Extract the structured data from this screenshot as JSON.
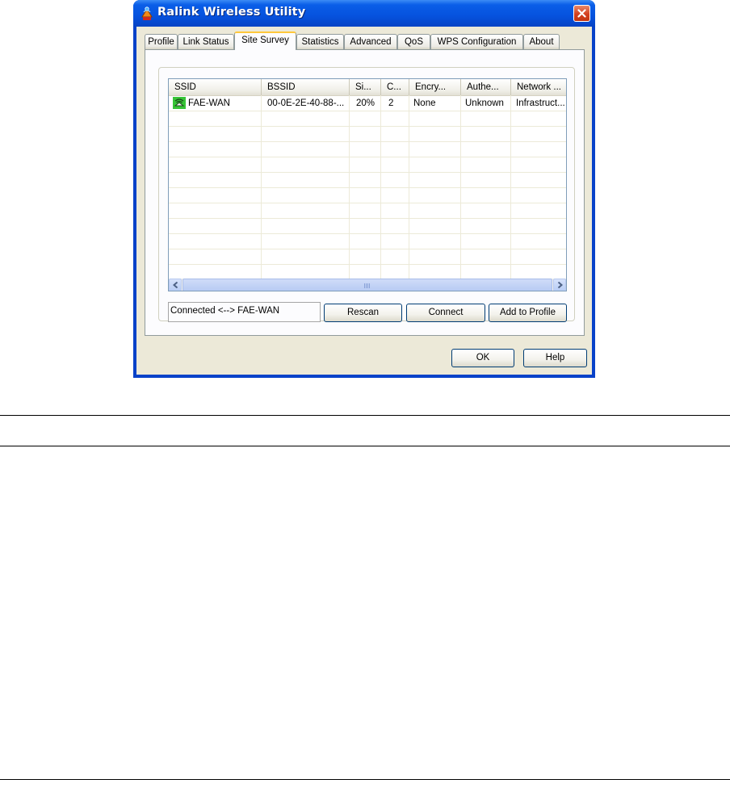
{
  "window": {
    "title": "Ralink Wireless Utility",
    "close_icon": "close-icon",
    "app_icon": "ralink-app-icon"
  },
  "tabs": [
    {
      "label": "Profile",
      "active": false
    },
    {
      "label": "Link Status",
      "active": false
    },
    {
      "label": "Site Survey",
      "active": true
    },
    {
      "label": "Statistics",
      "active": false
    },
    {
      "label": "Advanced",
      "active": false
    },
    {
      "label": "QoS",
      "active": false
    },
    {
      "label": "WPS Configuration",
      "active": false
    },
    {
      "label": "About",
      "active": false
    }
  ],
  "site_survey": {
    "columns": [
      "SSID",
      "BSSID",
      "Si...",
      "C...",
      "Encry...",
      "Authe...",
      "Network ..."
    ],
    "networks": [
      {
        "connected_icon": "connected-network-icon",
        "ssid": "FAE-WAN",
        "bssid": "00-0E-2E-40-88-...",
        "signal": "20%",
        "channel": "2",
        "encryption": "None",
        "authentication": "Unknown",
        "network_type": "Infrastruct..."
      }
    ],
    "status": "Connected <--> FAE-WAN",
    "rescan_label": "Rescan",
    "connect_label": "Connect",
    "add_to_profile_label": "Add to Profile"
  },
  "footer": {
    "ok_label": "OK",
    "help_label": "Help"
  }
}
